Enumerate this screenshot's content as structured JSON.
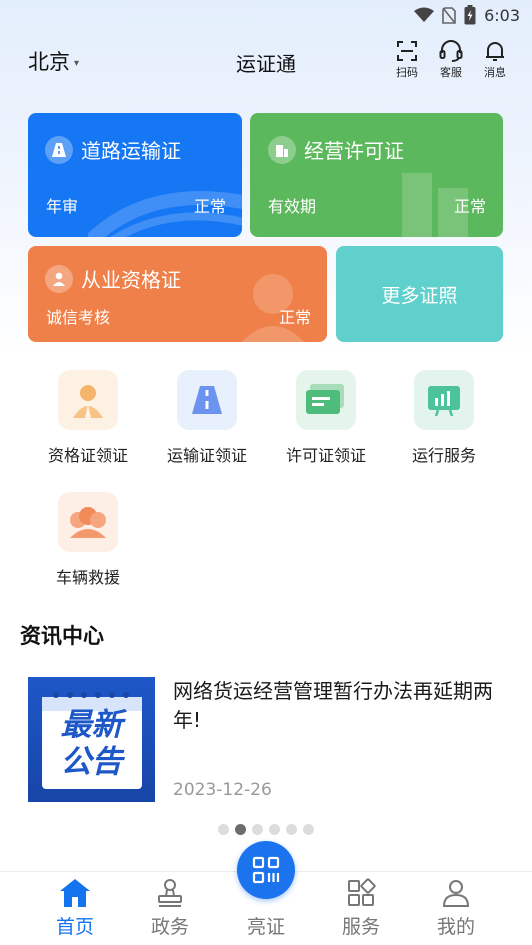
{
  "status_bar": {
    "time": "6:03"
  },
  "header": {
    "city": "北京",
    "title": "运证通",
    "actions": [
      {
        "label": "扫码",
        "icon": "scan-icon"
      },
      {
        "label": "客服",
        "icon": "headset-icon"
      },
      {
        "label": "消息",
        "icon": "bell-icon"
      }
    ]
  },
  "cards": {
    "road": {
      "title": "道路运输证",
      "sub": "年审",
      "status": "正常",
      "color": "#1677f5"
    },
    "license": {
      "title": "经营许可证",
      "sub": "有效期",
      "status": "正常",
      "color": "#5cb85c"
    },
    "qualification": {
      "title": "从业资格证",
      "sub": "诚信考核",
      "status": "正常",
      "color": "#f0804a"
    },
    "more": {
      "title": "更多证照",
      "color": "#5fd0cb"
    }
  },
  "services": [
    {
      "label": "资格证领证",
      "icon": "person-badge-icon"
    },
    {
      "label": "运输证领证",
      "icon": "road-icon"
    },
    {
      "label": "许可证领证",
      "icon": "card-icon"
    },
    {
      "label": "运行服务",
      "icon": "chart-board-icon"
    },
    {
      "label": "车辆救援",
      "icon": "rescue-icon"
    }
  ],
  "news": {
    "section_title": "资讯中心",
    "items": [
      {
        "thumb_line1": "最新",
        "thumb_line2": "公告",
        "title": "网络货运经营管理暂行办法再延期两年!",
        "date": "2023-12-26"
      }
    ],
    "carousel_pages": 6,
    "carousel_active": 2
  },
  "tabbar": {
    "tabs": [
      {
        "label": "首页",
        "icon": "home-icon",
        "active": true
      },
      {
        "label": "政务",
        "icon": "stamp-icon",
        "active": false
      },
      {
        "label": "亮证",
        "icon": "qr-code-icon",
        "active": false
      },
      {
        "label": "服务",
        "icon": "apps-icon",
        "active": false
      },
      {
        "label": "我的",
        "icon": "user-icon",
        "active": false
      }
    ]
  }
}
